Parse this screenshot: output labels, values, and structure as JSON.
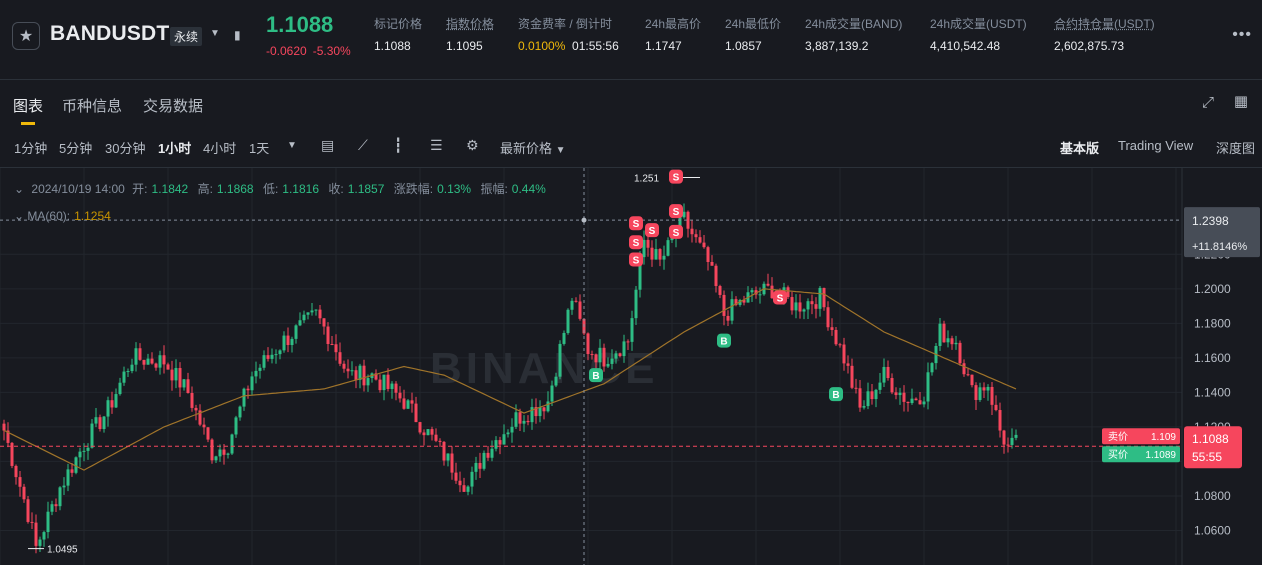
{
  "header": {
    "symbol": "BANDUSDT",
    "contract_type": "永续",
    "last_price": "1.1088",
    "change_abs": "-0.0620",
    "change_pct": "-5.30%",
    "stats": [
      {
        "label": "标记价格",
        "value": "1.1088"
      },
      {
        "label": "指数价格",
        "value": "1.1095"
      },
      {
        "label": "资金费率 / 倒计时",
        "value": "0.0100%",
        "value2": "01:55:56"
      },
      {
        "label": "24h最高价",
        "value": "1.1747"
      },
      {
        "label": "24h最低价",
        "value": "1.0857"
      },
      {
        "label": "24h成交量(BAND)",
        "value": "3,887,139.2"
      },
      {
        "label": "24h成交量(USDT)",
        "value": "4,410,542.48"
      },
      {
        "label": "合约持仓量(USDT)",
        "value": "2,602,875.73"
      }
    ],
    "colors": {
      "up": "#2ebd85",
      "down": "#f6465d",
      "accent": "#f0b90b"
    }
  },
  "tabs": [
    "图表",
    "币种信息",
    "交易数据"
  ],
  "toolbar": {
    "intervals": [
      "1分钟",
      "5分钟",
      "30分钟",
      "1小时",
      "4小时",
      "1天"
    ],
    "active_interval": "1小时",
    "price_type": "最新价格",
    "versions": [
      "基本版",
      "Trading View",
      "深度图"
    ],
    "active_version": "基本版"
  },
  "legend": {
    "date": "2024/10/19 14:00",
    "open_label": "开:",
    "open": "1.1842",
    "high_label": "高:",
    "high": "1.1868",
    "low_label": "低:",
    "low": "1.1816",
    "close_label": "收:",
    "close": "1.1857",
    "chg_label": "涨跌幅:",
    "chg": "0.13%",
    "amp_label": "振幅:",
    "amp": "0.44%",
    "ma_label": "MA(60):",
    "ma_value": "1.1254"
  },
  "watermark": "BINANCE",
  "chart_data": {
    "type": "candlestick",
    "y_ticks": [
      "1.2200",
      "1.2000",
      "1.1800",
      "1.1600",
      "1.1400",
      "1.1200",
      "1.0800",
      "1.0600"
    ],
    "ylim": [
      1.04,
      1.27
    ],
    "cursor_price": "1.2398",
    "cursor_pct": "+11.8146%",
    "current_price": "1.1088",
    "countdown": "55:55",
    "ask_label": "卖价",
    "ask": "1.109",
    "bid_label": "买价",
    "bid": "1.1089",
    "low_label": "1.0495",
    "high_label": "1.251",
    "markers": [
      {
        "label": "S",
        "type": "sell",
        "index": 168,
        "price": 1.265
      },
      {
        "label": "S",
        "type": "sell",
        "index": 168,
        "price": 1.245
      },
      {
        "label": "S",
        "type": "sell",
        "index": 158,
        "price": 1.238
      },
      {
        "label": "S",
        "type": "sell",
        "index": 162,
        "price": 1.234
      },
      {
        "label": "S",
        "type": "sell",
        "index": 168,
        "price": 1.233
      },
      {
        "label": "S",
        "type": "sell",
        "index": 158,
        "price": 1.227
      },
      {
        "label": "S",
        "type": "sell",
        "index": 158,
        "price": 1.217
      },
      {
        "label": "S",
        "type": "sell",
        "index": 194,
        "price": 1.195
      },
      {
        "label": "B",
        "type": "buy",
        "index": 180,
        "price": 1.17
      },
      {
        "label": "B",
        "type": "buy",
        "index": 148,
        "price": 1.15
      },
      {
        "label": "B",
        "type": "buy",
        "index": 208,
        "price": 1.139
      }
    ],
    "anchors": [
      [
        0,
        1.118
      ],
      [
        6,
        1.07
      ],
      [
        8,
        1.05
      ],
      [
        14,
        1.085
      ],
      [
        20,
        1.11
      ],
      [
        26,
        1.13
      ],
      [
        32,
        1.16
      ],
      [
        40,
        1.158
      ],
      [
        46,
        1.14
      ],
      [
        52,
        1.105
      ],
      [
        56,
        1.11
      ],
      [
        62,
        1.15
      ],
      [
        70,
        1.17
      ],
      [
        78,
        1.185
      ],
      [
        82,
        1.17
      ],
      [
        86,
        1.15
      ],
      [
        92,
        1.15
      ],
      [
        100,
        1.135
      ],
      [
        108,
        1.11
      ],
      [
        116,
        1.085
      ],
      [
        120,
        1.105
      ],
      [
        128,
        1.125
      ],
      [
        136,
        1.135
      ],
      [
        142,
        1.195
      ],
      [
        146,
        1.165
      ],
      [
        150,
        1.16
      ],
      [
        156,
        1.17
      ],
      [
        160,
        1.228
      ],
      [
        164,
        1.215
      ],
      [
        170,
        1.24
      ],
      [
        176,
        1.215
      ],
      [
        180,
        1.185
      ],
      [
        186,
        1.195
      ],
      [
        192,
        1.2
      ],
      [
        198,
        1.19
      ],
      [
        204,
        1.195
      ],
      [
        210,
        1.16
      ],
      [
        214,
        1.13
      ],
      [
        220,
        1.15
      ],
      [
        226,
        1.135
      ],
      [
        230,
        1.14
      ],
      [
        234,
        1.175
      ],
      [
        238,
        1.17
      ],
      [
        242,
        1.14
      ],
      [
        246,
        1.145
      ],
      [
        249,
        1.118
      ],
      [
        251,
        1.108
      ],
      [
        253,
        1.11
      ]
    ],
    "ma_anchors": [
      [
        0,
        1.118
      ],
      [
        20,
        1.095
      ],
      [
        40,
        1.12
      ],
      [
        60,
        1.138
      ],
      [
        80,
        1.142
      ],
      [
        100,
        1.155
      ],
      [
        110,
        1.15
      ],
      [
        130,
        1.128
      ],
      [
        150,
        1.145
      ],
      [
        170,
        1.175
      ],
      [
        190,
        1.2
      ],
      [
        205,
        1.197
      ],
      [
        220,
        1.175
      ],
      [
        235,
        1.16
      ],
      [
        253,
        1.142
      ]
    ]
  }
}
